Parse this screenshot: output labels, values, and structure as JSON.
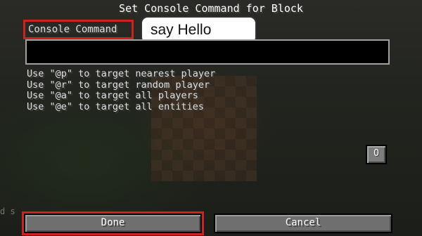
{
  "title": "Set Console Command for Block",
  "command": {
    "label": "Console Command",
    "value": ""
  },
  "annotation": {
    "bubble_text": "say Hello"
  },
  "hints": [
    "Use \"@p\" to target nearest player",
    "Use \"@r\" to target random player",
    "Use \"@a\" to target all players",
    "Use \"@e\" to target all entities"
  ],
  "output_toggle_label": "O",
  "chat_fragment": "d s\n",
  "buttons": {
    "done_label": "Done",
    "cancel_label": "Cancel"
  },
  "colors": {
    "highlight": "#cc2222",
    "text": "#e0e0e0",
    "button": "#6f6f6f"
  }
}
